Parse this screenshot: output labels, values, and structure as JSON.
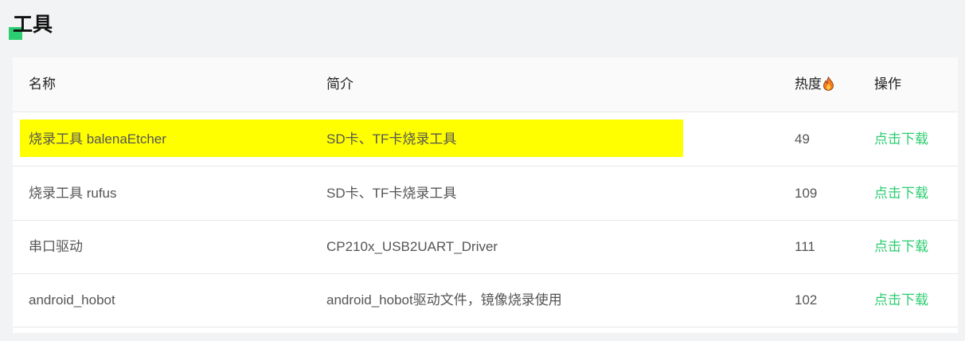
{
  "section": {
    "title": "工具"
  },
  "table": {
    "headers": {
      "name": "名称",
      "description": "简介",
      "heat": "热度",
      "heat_icon": "fire-icon",
      "action": "操作"
    },
    "rows": [
      {
        "name": "烧录工具 balenaEtcher",
        "description": "SD卡、TF卡烧录工具",
        "heat": "49",
        "action": "点击下载",
        "highlighted": true
      },
      {
        "name": "烧录工具 rufus",
        "description": "SD卡、TF卡烧录工具",
        "heat": "109",
        "action": "点击下载",
        "highlighted": false
      },
      {
        "name": "串口驱动",
        "description": "CP210x_USB2UART_Driver",
        "heat": "111",
        "action": "点击下载",
        "highlighted": false
      },
      {
        "name": "android_hobot",
        "description": "android_hobot驱动文件，镜像烧录使用",
        "heat": "102",
        "action": "点击下载",
        "highlighted": false
      }
    ]
  },
  "colors": {
    "accent": "#2bcd70",
    "highlight": "#ffff00",
    "page_background": "#f2f3f5",
    "header_background": "#fafafa"
  }
}
